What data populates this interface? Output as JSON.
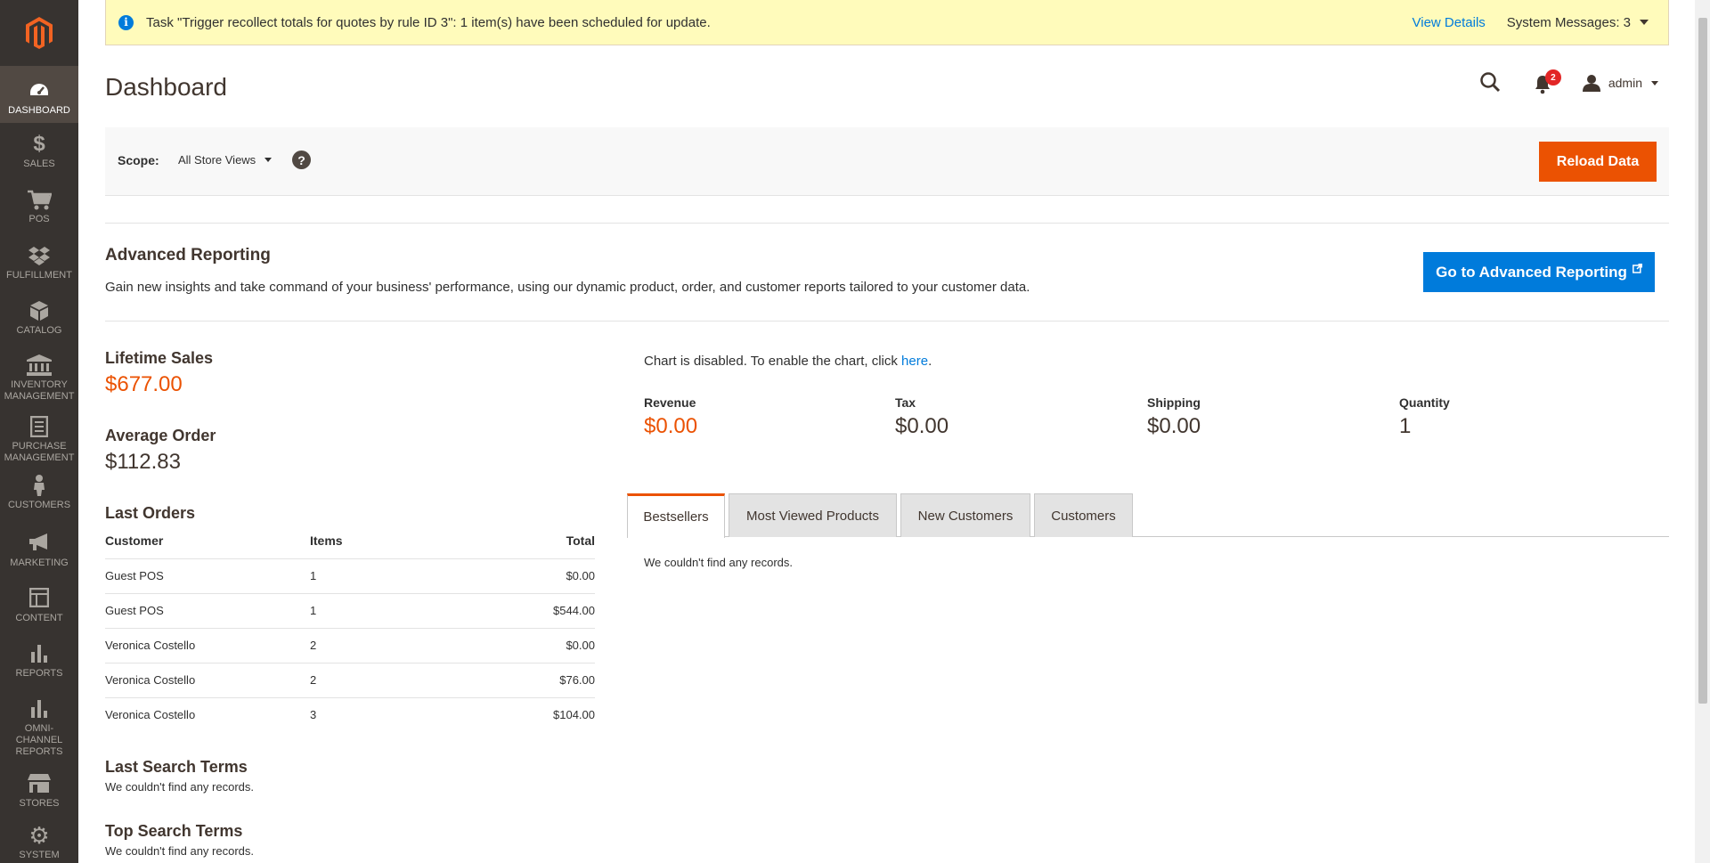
{
  "sidebar": {
    "items": [
      {
        "label": "DASHBOARD",
        "icon": "dashboard-icon"
      },
      {
        "label": "SALES",
        "icon": "dollar-icon"
      },
      {
        "label": "POS",
        "icon": "cart-icon"
      },
      {
        "label": "FULFILLMENT",
        "icon": "dropbox-icon"
      },
      {
        "label": "CATALOG",
        "icon": "box-icon"
      },
      {
        "label": "INVENTORY MANAGEMENT",
        "icon": "bank-icon"
      },
      {
        "label": "PURCHASE MANAGEMENT",
        "icon": "list-icon"
      },
      {
        "label": "CUSTOMERS",
        "icon": "person-icon"
      },
      {
        "label": "MARKETING",
        "icon": "megaphone-icon"
      },
      {
        "label": "CONTENT",
        "icon": "layout-icon"
      },
      {
        "label": "REPORTS",
        "icon": "bar-chart-icon"
      },
      {
        "label": "OMNI-CHANNEL REPORTS",
        "icon": "bar-chart-icon"
      },
      {
        "label": "STORES",
        "icon": "store-icon"
      },
      {
        "label": "SYSTEM",
        "icon": "gear-icon"
      }
    ]
  },
  "notice": {
    "message": "Task \"Trigger recollect totals for quotes by rule ID 3\": 1 item(s) have been scheduled for update.",
    "view_details": "View Details",
    "system_messages": "System Messages: 3"
  },
  "header": {
    "title": "Dashboard",
    "notification_count": "2",
    "user": "admin"
  },
  "scope": {
    "label": "Scope:",
    "value": "All Store Views",
    "help": "?",
    "reload_button": "Reload Data"
  },
  "advanced_reporting": {
    "title": "Advanced Reporting",
    "description": "Gain new insights and take command of your business' performance, using our dynamic product, order, and customer reports tailored to your customer data.",
    "button": "Go to Advanced Reporting"
  },
  "lifetime_sales": {
    "label": "Lifetime Sales",
    "value": "$677.00"
  },
  "average_order": {
    "label": "Average Order",
    "value": "$112.83"
  },
  "last_orders": {
    "title": "Last Orders",
    "columns": [
      "Customer",
      "Items",
      "Total"
    ],
    "rows": [
      [
        "Guest POS",
        "1",
        "$0.00"
      ],
      [
        "Guest POS",
        "1",
        "$544.00"
      ],
      [
        "Veronica Costello",
        "2",
        "$0.00"
      ],
      [
        "Veronica Costello",
        "2",
        "$76.00"
      ],
      [
        "Veronica Costello",
        "3",
        "$104.00"
      ]
    ]
  },
  "last_search_terms": {
    "title": "Last Search Terms",
    "empty": "We couldn't find any records."
  },
  "top_search_terms": {
    "title": "Top Search Terms",
    "empty": "We couldn't find any records."
  },
  "chart": {
    "disabled_text": "Chart is disabled. To enable the chart, click ",
    "link": "here",
    "period": "."
  },
  "totals": [
    {
      "label": "Revenue",
      "value": "$0.00"
    },
    {
      "label": "Tax",
      "value": "$0.00"
    },
    {
      "label": "Shipping",
      "value": "$0.00"
    },
    {
      "label": "Quantity",
      "value": "1"
    }
  ],
  "tabs": {
    "items": [
      "Bestsellers",
      "Most Viewed Products",
      "New Customers",
      "Customers"
    ],
    "active": "Bestsellers",
    "empty": "We couldn't find any records."
  },
  "colors": {
    "accent": "#eb5202",
    "link": "#007bdb",
    "sidebar": "#373330",
    "notice": "#fffbbb"
  }
}
